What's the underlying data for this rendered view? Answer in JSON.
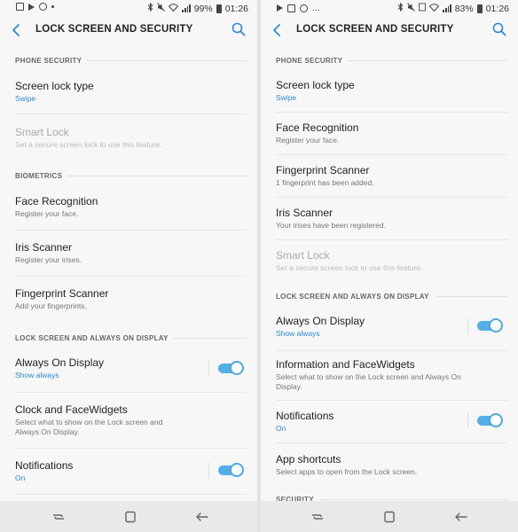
{
  "left": {
    "status": {
      "battery": "99%",
      "time": "01:26"
    },
    "title": "LOCK SCREEN AND SECURITY",
    "sections": {
      "phone_security": "PHONE SECURITY",
      "biometrics": "BIOMETRICS",
      "lock_aod": "LOCK SCREEN AND ALWAYS ON DISPLAY"
    },
    "items": {
      "screen_lock": {
        "title": "Screen lock type",
        "sub": "Swipe"
      },
      "smart_lock": {
        "title": "Smart Lock",
        "sub": "Set a secure screen lock to use this feature."
      },
      "face": {
        "title": "Face Recognition",
        "sub": "Register your face."
      },
      "iris": {
        "title": "Iris Scanner",
        "sub": "Register your irises."
      },
      "fingerprint": {
        "title": "Fingerprint Scanner",
        "sub": "Add your fingerprints."
      },
      "aod": {
        "title": "Always On Display",
        "sub": "Show always"
      },
      "clock": {
        "title": "Clock and FaceWidgets",
        "sub": "Select what to show on the Lock screen and Always On Display."
      },
      "notifications": {
        "title": "Notifications",
        "sub": "On"
      }
    }
  },
  "right": {
    "status": {
      "extra": "...",
      "battery": "83%",
      "time": "01:26"
    },
    "title": "LOCK SCREEN AND SECURITY",
    "sections": {
      "phone_security": "PHONE SECURITY",
      "lock_aod": "LOCK SCREEN AND ALWAYS ON DISPLAY",
      "security": "SECURITY"
    },
    "items": {
      "screen_lock": {
        "title": "Screen lock type",
        "sub": "Swipe"
      },
      "face": {
        "title": "Face Recognition",
        "sub": "Register your face."
      },
      "fingerprint": {
        "title": "Fingerprint Scanner",
        "sub": "1 fingerprint has been added."
      },
      "iris": {
        "title": "Iris Scanner",
        "sub": "Your irises have been registered."
      },
      "smart_lock": {
        "title": "Smart Lock",
        "sub": "Set a secure screen lock to use this feature."
      },
      "aod": {
        "title": "Always On Display",
        "sub": "Show always"
      },
      "info_face": {
        "title": "Information and FaceWidgets",
        "sub": "Select what to show on the Lock screen and Always On Display."
      },
      "notifications": {
        "title": "Notifications",
        "sub": "On"
      },
      "shortcuts": {
        "title": "App shortcuts",
        "sub": "Select apps to open from the Lock screen."
      }
    }
  },
  "colors": {
    "accent": "#2a8ad4",
    "toggle_on": "#55aee6",
    "background": "#f7f7f7"
  },
  "icons": [
    "back-arrow-icon",
    "search-icon",
    "recents-icon",
    "home-icon",
    "nav-back-icon",
    "bluetooth-icon",
    "wifi-icon",
    "signal-icon",
    "battery-icon"
  ]
}
